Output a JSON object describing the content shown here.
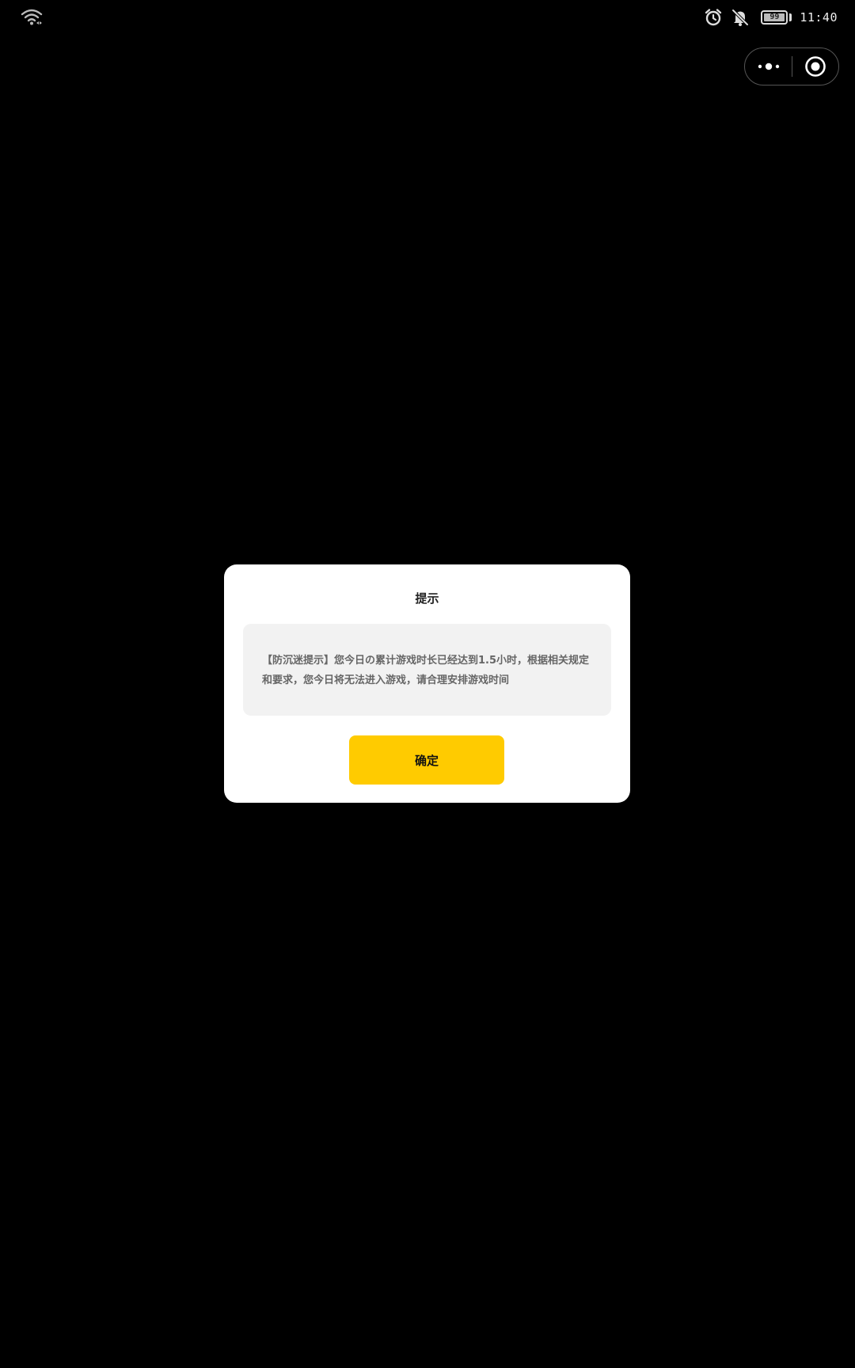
{
  "status_bar": {
    "battery_level": "99",
    "time": "11:40",
    "icons": [
      "wifi-icon",
      "alarm-icon",
      "bell-off-icon",
      "battery-icon"
    ]
  },
  "capsule": {
    "more_icon": "more-dots-icon",
    "close_icon": "close-target-icon"
  },
  "dialog": {
    "title": "提示",
    "message": "【防沉迷提示】您今日の累计游戏时长已经达到1.5小时，根据相关规定和要求，您今日将无法进入游戏，请合理安排游戏时间",
    "confirm_label": "确定",
    "confirm_color": "#ffcb00"
  }
}
